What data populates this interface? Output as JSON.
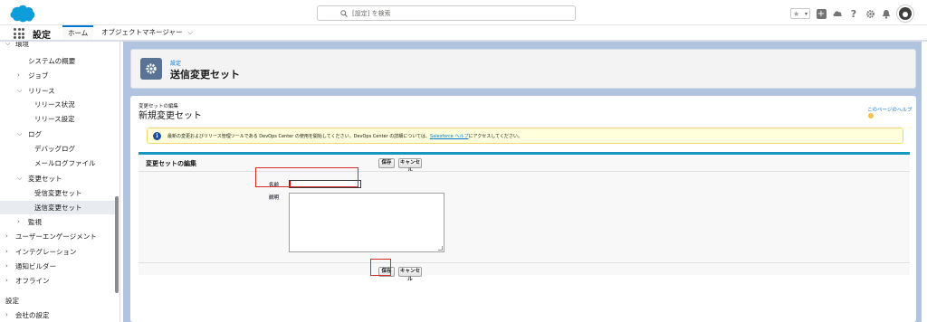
{
  "header": {
    "search_placeholder": "[設定] を検索",
    "icons": [
      "star-icon",
      "chevron-down-icon",
      "plus-icon",
      "cloud-icon",
      "help-icon",
      "gear-icon",
      "bell-icon",
      "avatar"
    ]
  },
  "nav": {
    "app_name": "設定",
    "tabs": [
      {
        "label": "ホーム",
        "active": true
      },
      {
        "label": "オブジェクトマネージャー",
        "active": false
      }
    ]
  },
  "sidebar": {
    "items": [
      {
        "label": "環境",
        "level": 0,
        "chevron": "down"
      },
      {
        "label": "システムの概要",
        "level": 1
      },
      {
        "label": "ジョブ",
        "level": 1,
        "chevron": "right"
      },
      {
        "label": "リリース",
        "level": 1,
        "chevron": "down"
      },
      {
        "label": "リリース状況",
        "level": 2
      },
      {
        "label": "リリース設定",
        "level": 2
      },
      {
        "label": "ログ",
        "level": 1,
        "chevron": "down"
      },
      {
        "label": "デバッグログ",
        "level": 2
      },
      {
        "label": "メールログファイル",
        "level": 2
      },
      {
        "label": "変更セット",
        "level": 1,
        "chevron": "down"
      },
      {
        "label": "受信変更セット",
        "level": 2
      },
      {
        "label": "送信変更セット",
        "level": 2,
        "selected": true
      },
      {
        "label": "監視",
        "level": 1,
        "chevron": "right"
      },
      {
        "label": "ユーザーエンゲージメント",
        "level": 0,
        "chevron": "right"
      },
      {
        "label": "インテグレーション",
        "level": 0,
        "chevron": "right"
      },
      {
        "label": "通知ビルダー",
        "level": 0,
        "chevron": "right"
      },
      {
        "label": "オフライン",
        "level": 0,
        "chevron": "right"
      }
    ],
    "section2_title": "設定",
    "section2_items": [
      {
        "label": "会社の設定",
        "chevron": "right"
      }
    ]
  },
  "page_header": {
    "breadcrumb": "設定",
    "title": "送信変更セット"
  },
  "content": {
    "breadcrumb": "変更セットの編集",
    "title": "新規変更セット",
    "help_link": "このページのヘルプ",
    "info_text_before": "最新の変更およびリリース管理ツールである DevOps Center の使用を開始してください。DevOps Center の詳細については、",
    "info_link": "Salesforce ヘルプ",
    "info_text_after": "にアクセスしてください。",
    "section_title": "変更セットの編集",
    "save_label": "保存",
    "cancel_label": "キャンセル",
    "name_label": "名前",
    "name_value": "",
    "description_label": "説明",
    "description_value": ""
  },
  "colors": {
    "brand_blue": "#0176d3",
    "main_bg": "#b0c4df",
    "section_accent": "#1797c0",
    "highlight_red": "#d42b2b",
    "info_bg": "#ffffdc"
  }
}
